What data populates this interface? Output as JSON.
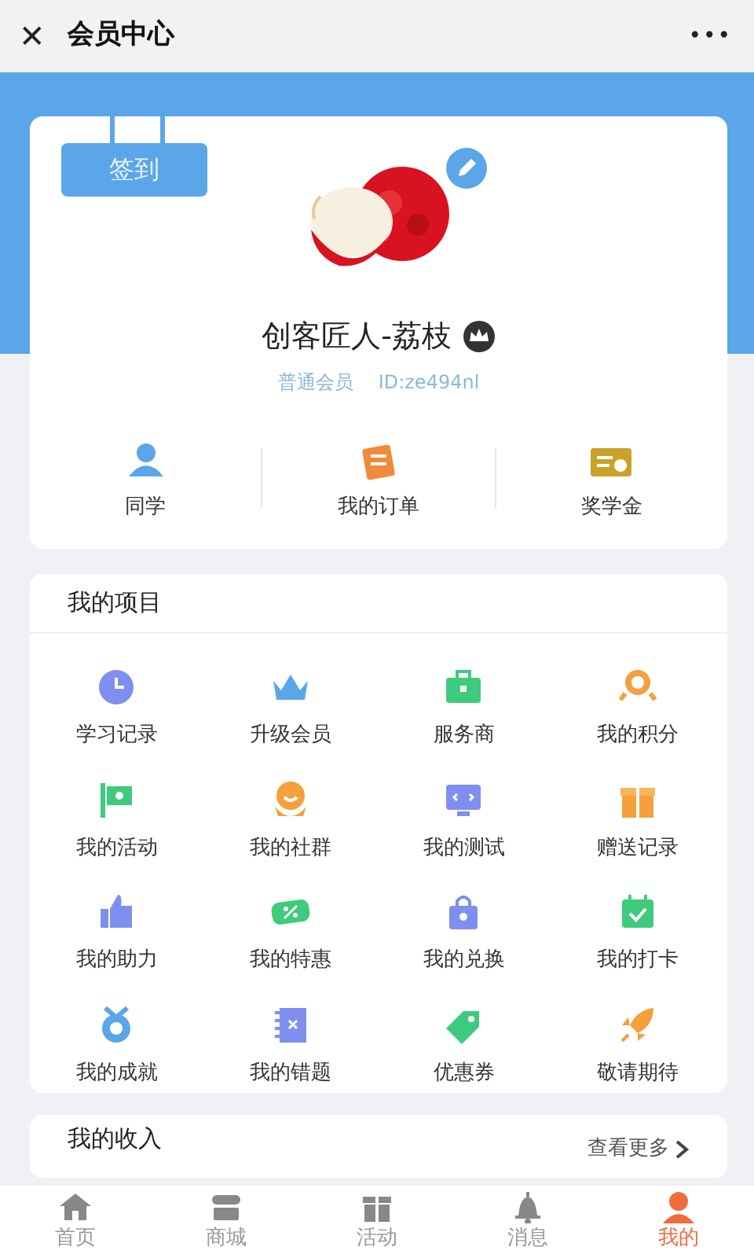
{
  "header": {
    "close": "✕",
    "title": "会员中心",
    "more": "•••"
  },
  "profile": {
    "checkin": "签到",
    "name": "创客匠人-荔枝",
    "level": "普通会员",
    "id": "ID:ze494nl"
  },
  "shortcuts": [
    {
      "label": "同学"
    },
    {
      "label": "我的订单"
    },
    {
      "label": "奖学金"
    }
  ],
  "projects": {
    "title": "我的项目",
    "items": [
      {
        "label": "学习记录"
      },
      {
        "label": "升级会员"
      },
      {
        "label": "服务商"
      },
      {
        "label": "我的积分"
      },
      {
        "label": "我的活动"
      },
      {
        "label": "我的社群"
      },
      {
        "label": "我的测试"
      },
      {
        "label": "赠送记录"
      },
      {
        "label": "我的助力"
      },
      {
        "label": "我的特惠"
      },
      {
        "label": "我的兑换"
      },
      {
        "label": "我的打卡"
      },
      {
        "label": "我的成就"
      },
      {
        "label": "我的错题"
      },
      {
        "label": "优惠券"
      },
      {
        "label": "敬请期待"
      }
    ]
  },
  "income": {
    "title": "我的收入",
    "more": "查看更多"
  },
  "tabs": [
    {
      "label": "首页",
      "selected": false
    },
    {
      "label": "商城",
      "selected": false
    },
    {
      "label": "活动",
      "selected": false
    },
    {
      "label": "消息",
      "selected": false
    },
    {
      "label": "我的",
      "selected": true
    }
  ]
}
